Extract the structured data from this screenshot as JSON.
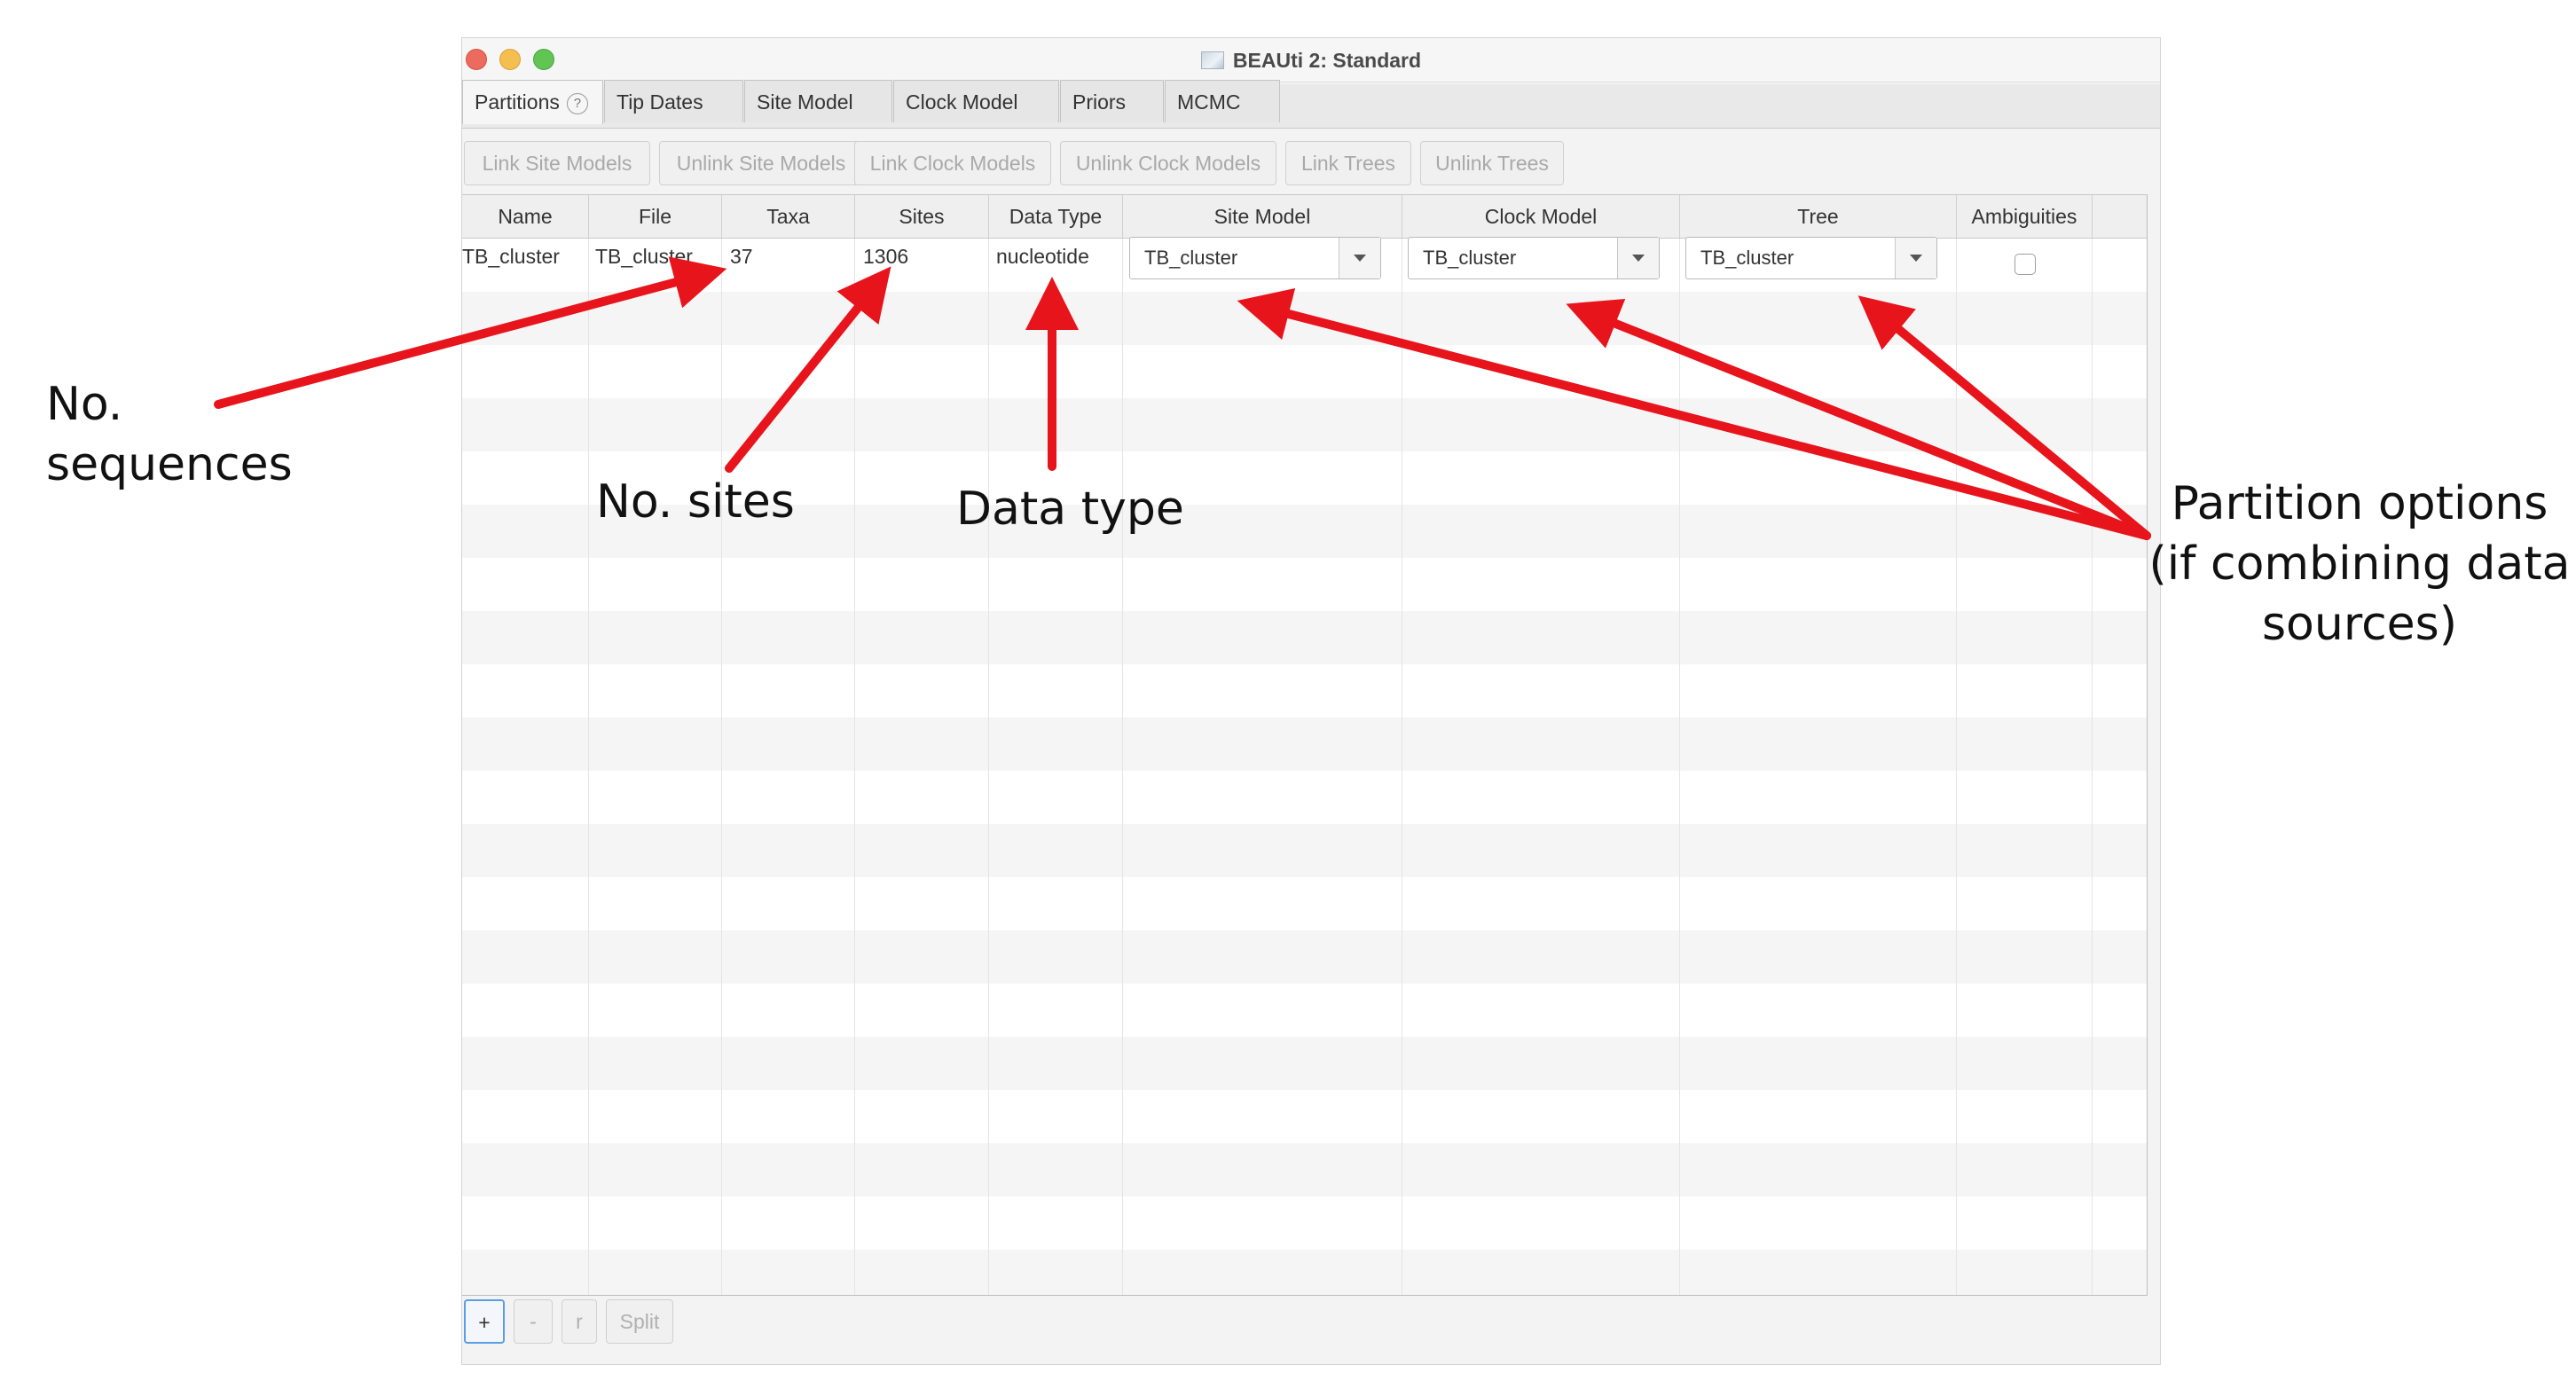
{
  "window": {
    "title": "BEAUti 2: Standard"
  },
  "tabs": [
    {
      "label": "Partitions",
      "active": true,
      "help": "?"
    },
    {
      "label": "Tip Dates"
    },
    {
      "label": "Site Model"
    },
    {
      "label": "Clock Model"
    },
    {
      "label": "Priors"
    },
    {
      "label": "MCMC"
    }
  ],
  "toolbar": [
    "Link Site Models",
    "Unlink Site Models",
    "Link Clock Models",
    "Unlink Clock Models",
    "Link Trees",
    "Unlink Trees"
  ],
  "table": {
    "columns": [
      "Name",
      "File",
      "Taxa",
      "Sites",
      "Data Type",
      "Site Model",
      "Clock Model",
      "Tree",
      "Ambiguities"
    ],
    "rows": [
      {
        "name": "TB_cluster",
        "file": "TB_cluster",
        "taxa": "37",
        "sites": "1306",
        "data_type": "nucleotide",
        "site_model": "TB_cluster",
        "clock_model": "TB_cluster",
        "tree": "TB_cluster",
        "ambiguities": false
      }
    ]
  },
  "bottom_buttons": [
    "+",
    "-",
    "r",
    "Split"
  ],
  "annotations": {
    "sequences": "No.\nsequences",
    "sites": "No. sites",
    "data_type": "Data type",
    "partition": "Partition options\n(if combining data\nsources)"
  },
  "colors": {
    "arrow": "#e8141c",
    "focus": "#5b9ee8"
  }
}
